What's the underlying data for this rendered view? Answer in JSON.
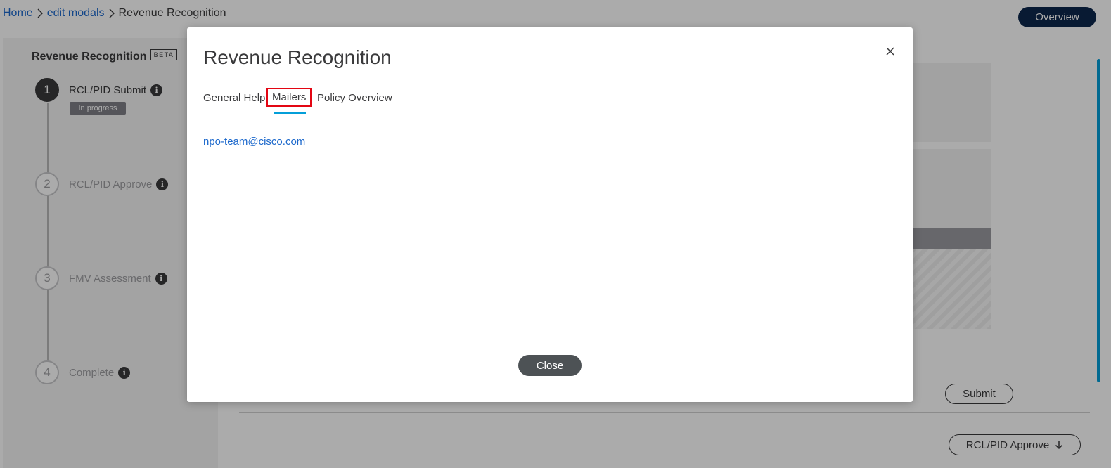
{
  "breadcrumb": {
    "items": [
      "Home",
      "edit modals",
      "Revenue Recognition"
    ]
  },
  "header": {
    "overview_label": "Overview"
  },
  "stepper": {
    "title": "Revenue Recognition",
    "badge": "BETA",
    "steps": [
      {
        "number": "1",
        "label": "RCL/PID Submit",
        "status": "In progress",
        "active": true
      },
      {
        "number": "2",
        "label": "RCL/PID Approve",
        "active": false
      },
      {
        "number": "3",
        "label": "FMV Assessment",
        "active": false
      },
      {
        "number": "4",
        "label": "Complete",
        "active": false
      }
    ],
    "info_glyph": "i"
  },
  "content": {
    "submit_label": "Submit",
    "next_step_label": "RCL/PID Approve"
  },
  "modal": {
    "title": "Revenue Recognition",
    "tabs": [
      {
        "label": "General Help",
        "selected": false
      },
      {
        "label": "Mailers",
        "selected": true
      },
      {
        "label": "Policy Overview",
        "selected": false
      }
    ],
    "mailer_email": "npo-team@cisco.com",
    "close_label": "Close"
  },
  "colors": {
    "accent_blue": "#049fd9",
    "link_blue": "#1d69cc",
    "overview_button": "#0d274d",
    "close_button": "#4d5255",
    "highlight_red": "#e30613"
  },
  "icons": [
    "chevron-right-icon",
    "info-icon",
    "close-icon",
    "arrow-down-icon"
  ]
}
